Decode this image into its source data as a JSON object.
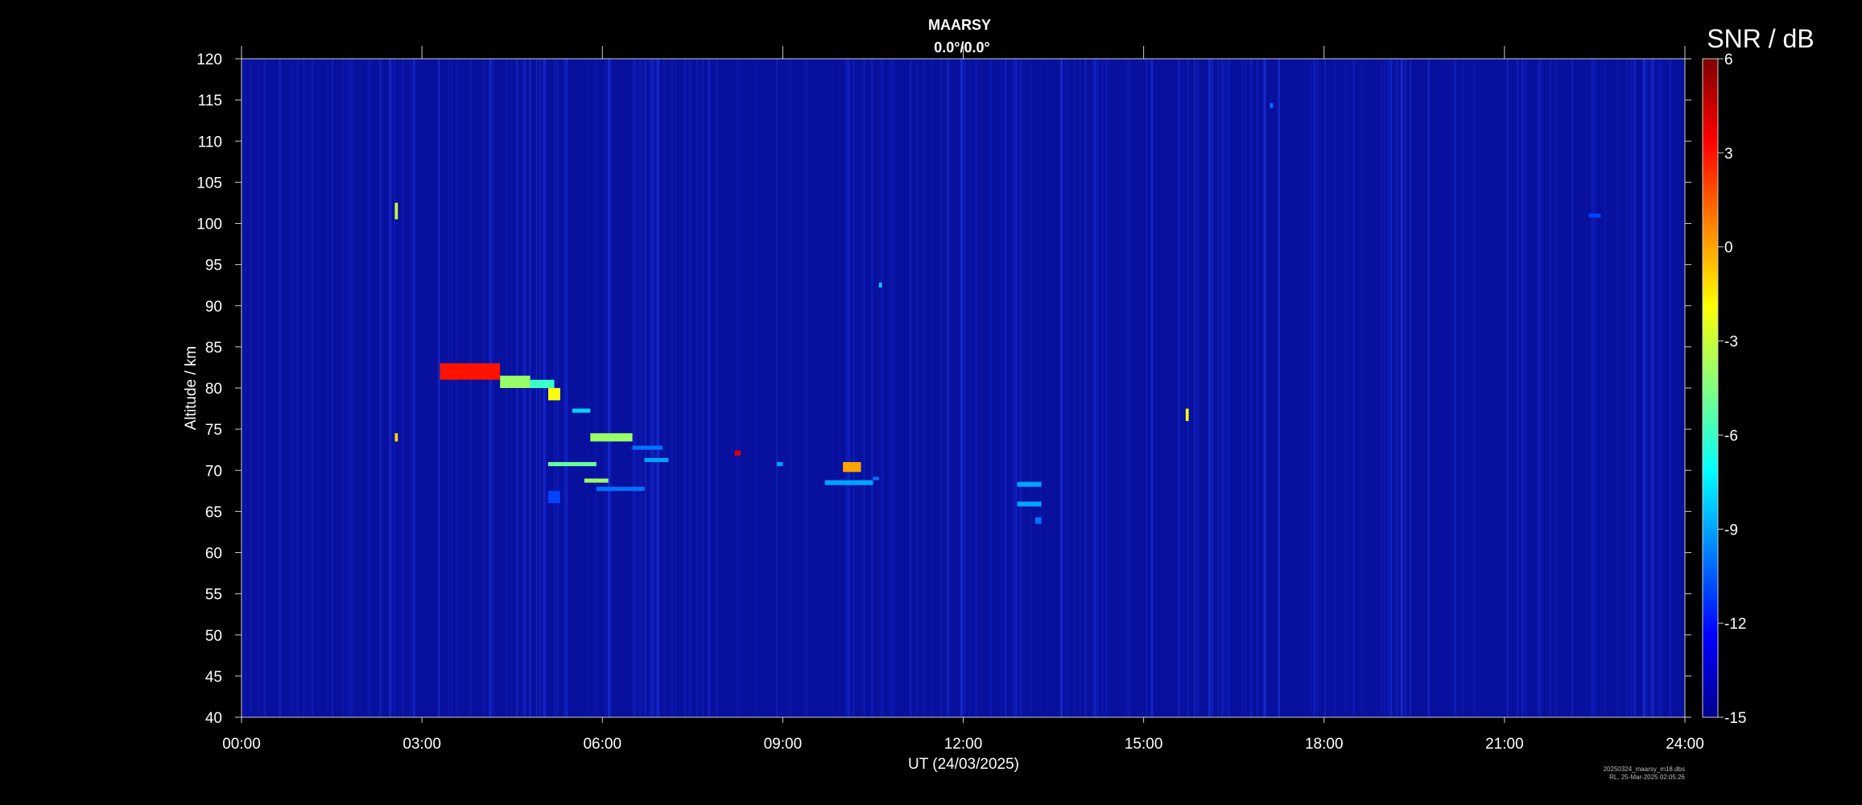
{
  "chart_data": {
    "type": "heatmap",
    "title": "MAARSY",
    "subtitle": "0.0°/0.0°",
    "xlabel": "UT (24/03/2025)",
    "ylabel": "Altitude / km",
    "colorbar_label": "SNR / dB",
    "x_ticks": [
      "00:00",
      "03:00",
      "06:00",
      "09:00",
      "12:00",
      "15:00",
      "18:00",
      "21:00",
      "24:00"
    ],
    "xlim_hours": [
      0,
      24
    ],
    "y_ticks": [
      40,
      45,
      50,
      55,
      60,
      65,
      70,
      75,
      80,
      85,
      90,
      95,
      100,
      105,
      110,
      115,
      120
    ],
    "ylim_km": [
      40,
      120
    ],
    "colorbar_ticks": [
      6,
      3,
      0,
      -3,
      -6,
      -9,
      -12,
      -15
    ],
    "clim_db": [
      -15,
      6
    ],
    "colormap": [
      "#00008f",
      "#0000ff",
      "#00ffff",
      "#ffff00",
      "#ff0000",
      "#800000"
    ],
    "background_value_db": -14,
    "echoes": [
      {
        "hour": 3.3,
        "hour_end": 4.3,
        "alt": 81.0,
        "alt_top": 83.0,
        "snr": 3
      },
      {
        "hour": 4.3,
        "hour_end": 4.8,
        "alt": 80.0,
        "alt_top": 81.5,
        "snr": -4
      },
      {
        "hour": 4.8,
        "hour_end": 5.2,
        "alt": 80.0,
        "alt_top": 81.0,
        "snr": -6
      },
      {
        "hour": 5.1,
        "hour_end": 5.3,
        "alt": 78.5,
        "alt_top": 80.0,
        "snr": -2
      },
      {
        "hour": 5.5,
        "hour_end": 5.8,
        "alt": 77.0,
        "alt_top": 77.5,
        "snr": -8
      },
      {
        "hour": 5.8,
        "hour_end": 6.5,
        "alt": 73.5,
        "alt_top": 74.5,
        "snr": -4
      },
      {
        "hour": 6.5,
        "hour_end": 7.0,
        "alt": 72.5,
        "alt_top": 73.0,
        "snr": -10
      },
      {
        "hour": 6.7,
        "hour_end": 7.1,
        "alt": 71.0,
        "alt_top": 71.5,
        "snr": -9
      },
      {
        "hour": 5.1,
        "hour_end": 5.9,
        "alt": 70.5,
        "alt_top": 71.0,
        "snr": -5
      },
      {
        "hour": 5.7,
        "hour_end": 6.1,
        "alt": 68.5,
        "alt_top": 69.0,
        "snr": -4
      },
      {
        "hour": 5.9,
        "hour_end": 6.7,
        "alt": 67.5,
        "alt_top": 68.0,
        "snr": -10
      },
      {
        "hour": 5.1,
        "hour_end": 5.3,
        "alt": 66.0,
        "alt_top": 67.5,
        "snr": -11
      },
      {
        "hour": 8.2,
        "hour_end": 8.3,
        "alt": 71.8,
        "alt_top": 72.4,
        "snr": 4
      },
      {
        "hour": 8.9,
        "hour_end": 9.0,
        "alt": 70.5,
        "alt_top": 71.0,
        "snr": -9
      },
      {
        "hour": 9.7,
        "hour_end": 10.5,
        "alt": 68.2,
        "alt_top": 68.8,
        "snr": -9
      },
      {
        "hour": 10.0,
        "hour_end": 10.3,
        "alt": 69.8,
        "alt_top": 71.0,
        "snr": 0
      },
      {
        "hour": 10.5,
        "hour_end": 10.6,
        "alt": 68.8,
        "alt_top": 69.2,
        "snr": -10
      },
      {
        "hour": 12.9,
        "hour_end": 13.3,
        "alt": 68.0,
        "alt_top": 68.6,
        "snr": -9
      },
      {
        "hour": 12.9,
        "hour_end": 13.3,
        "alt": 65.6,
        "alt_top": 66.2,
        "snr": -9
      },
      {
        "hour": 13.2,
        "hour_end": 13.3,
        "alt": 63.5,
        "alt_top": 64.3,
        "snr": -10
      },
      {
        "hour": 15.7,
        "hour_end": 15.75,
        "alt": 76.0,
        "alt_top": 77.5,
        "snr": -2
      },
      {
        "hour": 2.55,
        "hour_end": 2.6,
        "alt": 100.5,
        "alt_top": 102.5,
        "snr": -3
      },
      {
        "hour": 2.55,
        "hour_end": 2.6,
        "alt": 73.5,
        "alt_top": 74.5,
        "snr": -1
      },
      {
        "hour": 10.6,
        "hour_end": 10.65,
        "alt": 92.2,
        "alt_top": 92.8,
        "snr": -8
      },
      {
        "hour": 17.1,
        "hour_end": 17.15,
        "alt": 114.0,
        "alt_top": 114.6,
        "snr": -10
      },
      {
        "hour": 22.4,
        "hour_end": 22.6,
        "alt": 100.7,
        "alt_top": 101.2,
        "snr": -11
      }
    ]
  },
  "footer": {
    "line1": "20250324_maarsy_m18.dbs",
    "line2": "RL, 25-Mar-2025 02:05:26"
  }
}
